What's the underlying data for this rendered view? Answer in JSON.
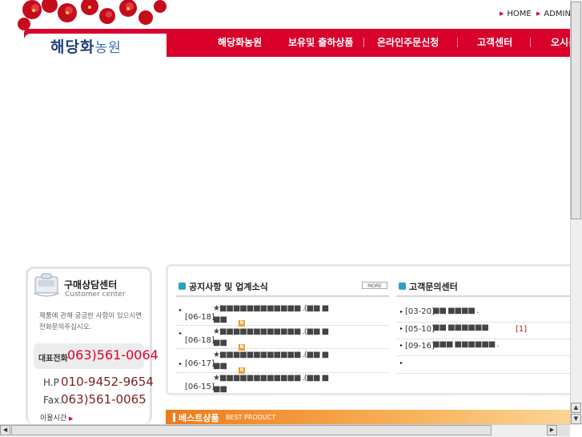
{
  "top_links": [
    {
      "label": "HOME"
    },
    {
      "label": "ADMIN"
    }
  ],
  "logo": {
    "text_main": "해당화",
    "text_sub": "농원"
  },
  "nav": {
    "items": [
      {
        "label": "해당화농원"
      },
      {
        "label": "보유및 출하상품"
      },
      {
        "label": "온라인주문신청"
      },
      {
        "label": "고객센터"
      },
      {
        "label": "오시는"
      }
    ]
  },
  "customer_center": {
    "title": "구매상담센터",
    "subtitle": "Customer center",
    "description_line1": "제품에 관해 궁금한 사항이 있으시면",
    "description_line2": "전화문의주십시오.",
    "main_phone_label": "대표전화",
    "main_phone": "063)561-0064",
    "mobile_label": "H.P",
    "mobile": "010-9452-9654",
    "fax_label": "Fax.",
    "fax": "063)561-0065",
    "hours_label": "이용시간"
  },
  "notice": {
    "title": "공지사항 및 업계소식",
    "more_label": "MORE",
    "items": [
      {
        "date": "[06-18]",
        "text": "★■■■■■■■■■■■■ .(■■ ■",
        "text2": "■■",
        "is_new": true
      },
      {
        "date": "[06-18]",
        "text": "★■■■■■■■■■■■■ .(■■ ■",
        "text2": "■■",
        "is_new": true
      },
      {
        "date": "[06-17]",
        "text": "★■■■■■■■■■■■■ .(■■ ■",
        "text2": "■■",
        "is_new": true
      },
      {
        "date": "[06-15]",
        "text": "★■■■■■■■■■■■■ .(■■ ■",
        "text2": "■■",
        "is_new": false
      }
    ]
  },
  "qna": {
    "title": "고객문의센터",
    "items": [
      {
        "date": "[03-20]",
        "text": "■■ ■■■■ .",
        "count": ""
      },
      {
        "date": "[05-10]",
        "text": "■■ ■■■■■■",
        "count": "[1]"
      },
      {
        "date": "[09-16]",
        "text": "■■■ ■■■■■■ .",
        "count": ""
      },
      {
        "date": "",
        "text": "",
        "count": ""
      }
    ]
  },
  "best": {
    "title": "베스트상품",
    "subtitle": "BEST PRODUCT"
  },
  "colors": {
    "nav_red": "#d9002c",
    "accent_red": "#c8102e",
    "logo_blue": "#1f3f7a",
    "best_orange": "#f07a1a",
    "new_badge": "#f29b1e"
  }
}
